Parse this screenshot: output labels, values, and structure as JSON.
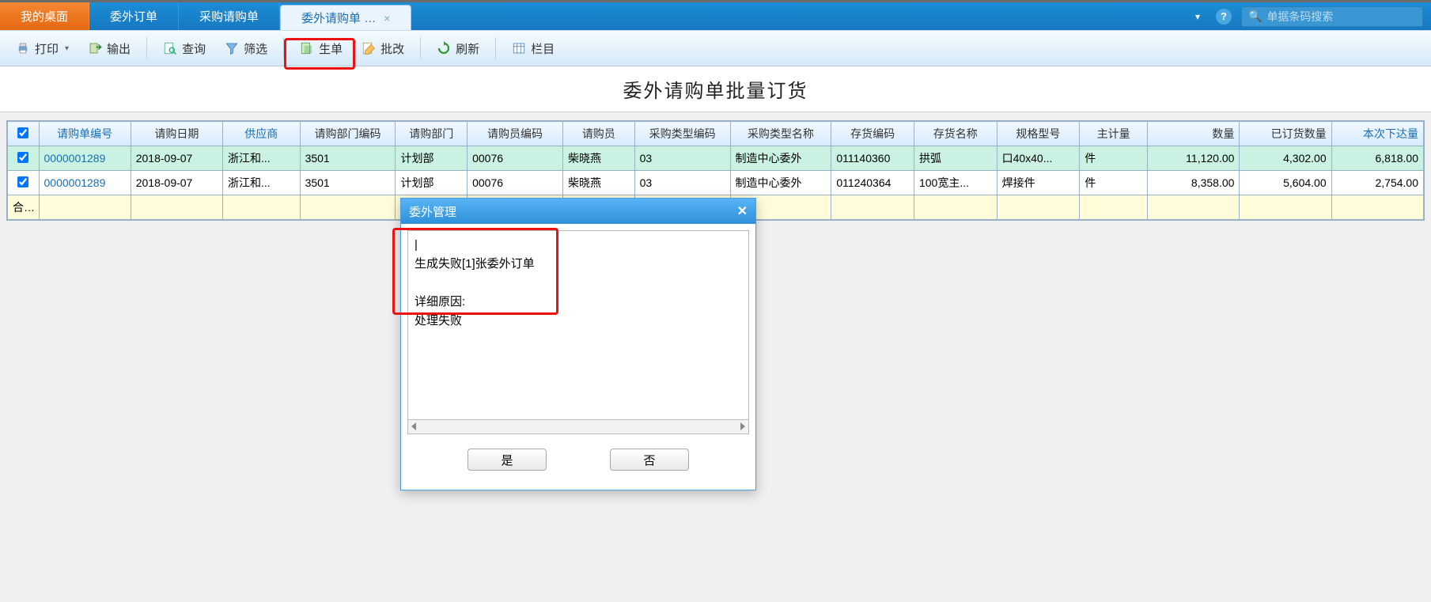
{
  "tabs": {
    "desktop": "我的桌面",
    "outsource_order": "委外订单",
    "purchase_req": "采购请购单",
    "outsource_req": "委外请购单 …"
  },
  "topbar": {
    "search_placeholder": "单据条码搜索",
    "help": "?"
  },
  "toolbar": {
    "print": "打印",
    "export": "输出",
    "query": "查询",
    "filter": "筛选",
    "generate": "生单",
    "batch_edit": "批改",
    "refresh": "刷新",
    "columns": "栏目"
  },
  "page_title": "委外请购单批量订货",
  "table": {
    "headers": {
      "chk": "",
      "req_no": "请购单编号",
      "req_date": "请购日期",
      "supplier": "供应商",
      "dept_code": "请购部门编码",
      "dept": "请购部门",
      "buyer_code": "请购员编码",
      "buyer": "请购员",
      "ptype_code": "采购类型编码",
      "ptype_name": "采购类型名称",
      "inv_code": "存货编码",
      "inv_name": "存货名称",
      "spec": "规格型号",
      "uom": "主计量",
      "qty": "数量",
      "ordered_qty": "已订货数量",
      "this_qty": "本次下达量"
    },
    "rows": [
      {
        "checked": true,
        "req_no": "0000001289",
        "req_date": "2018-09-07",
        "supplier": "浙江和...",
        "dept_code": "3501",
        "dept": "计划部",
        "buyer_code": "00076",
        "buyer": "柴晓燕",
        "ptype_code": "03",
        "ptype_name": "制造中心委外",
        "inv_code": "011140360",
        "inv_name": "拱弧",
        "spec": "口40x40...",
        "uom": "件",
        "qty": "11,120.00",
        "ordered_qty": "4,302.00",
        "this_qty": "6,818.00"
      },
      {
        "checked": true,
        "req_no": "0000001289",
        "req_date": "2018-09-07",
        "supplier": "浙江和...",
        "dept_code": "3501",
        "dept": "计划部",
        "buyer_code": "00076",
        "buyer": "柴晓燕",
        "ptype_code": "03",
        "ptype_name": "制造中心委外",
        "inv_code": "011240364",
        "inv_name": "100宽主...",
        "spec": "焊接件",
        "uom": "件",
        "qty": "8,358.00",
        "ordered_qty": "5,604.00",
        "this_qty": "2,754.00"
      }
    ],
    "total_label": "合计"
  },
  "dialog": {
    "title": "委外管理",
    "message": "|\n生成失败[1]张委外订单\n\n详细原因:\n处理失败",
    "yes": "是",
    "no": "否"
  }
}
